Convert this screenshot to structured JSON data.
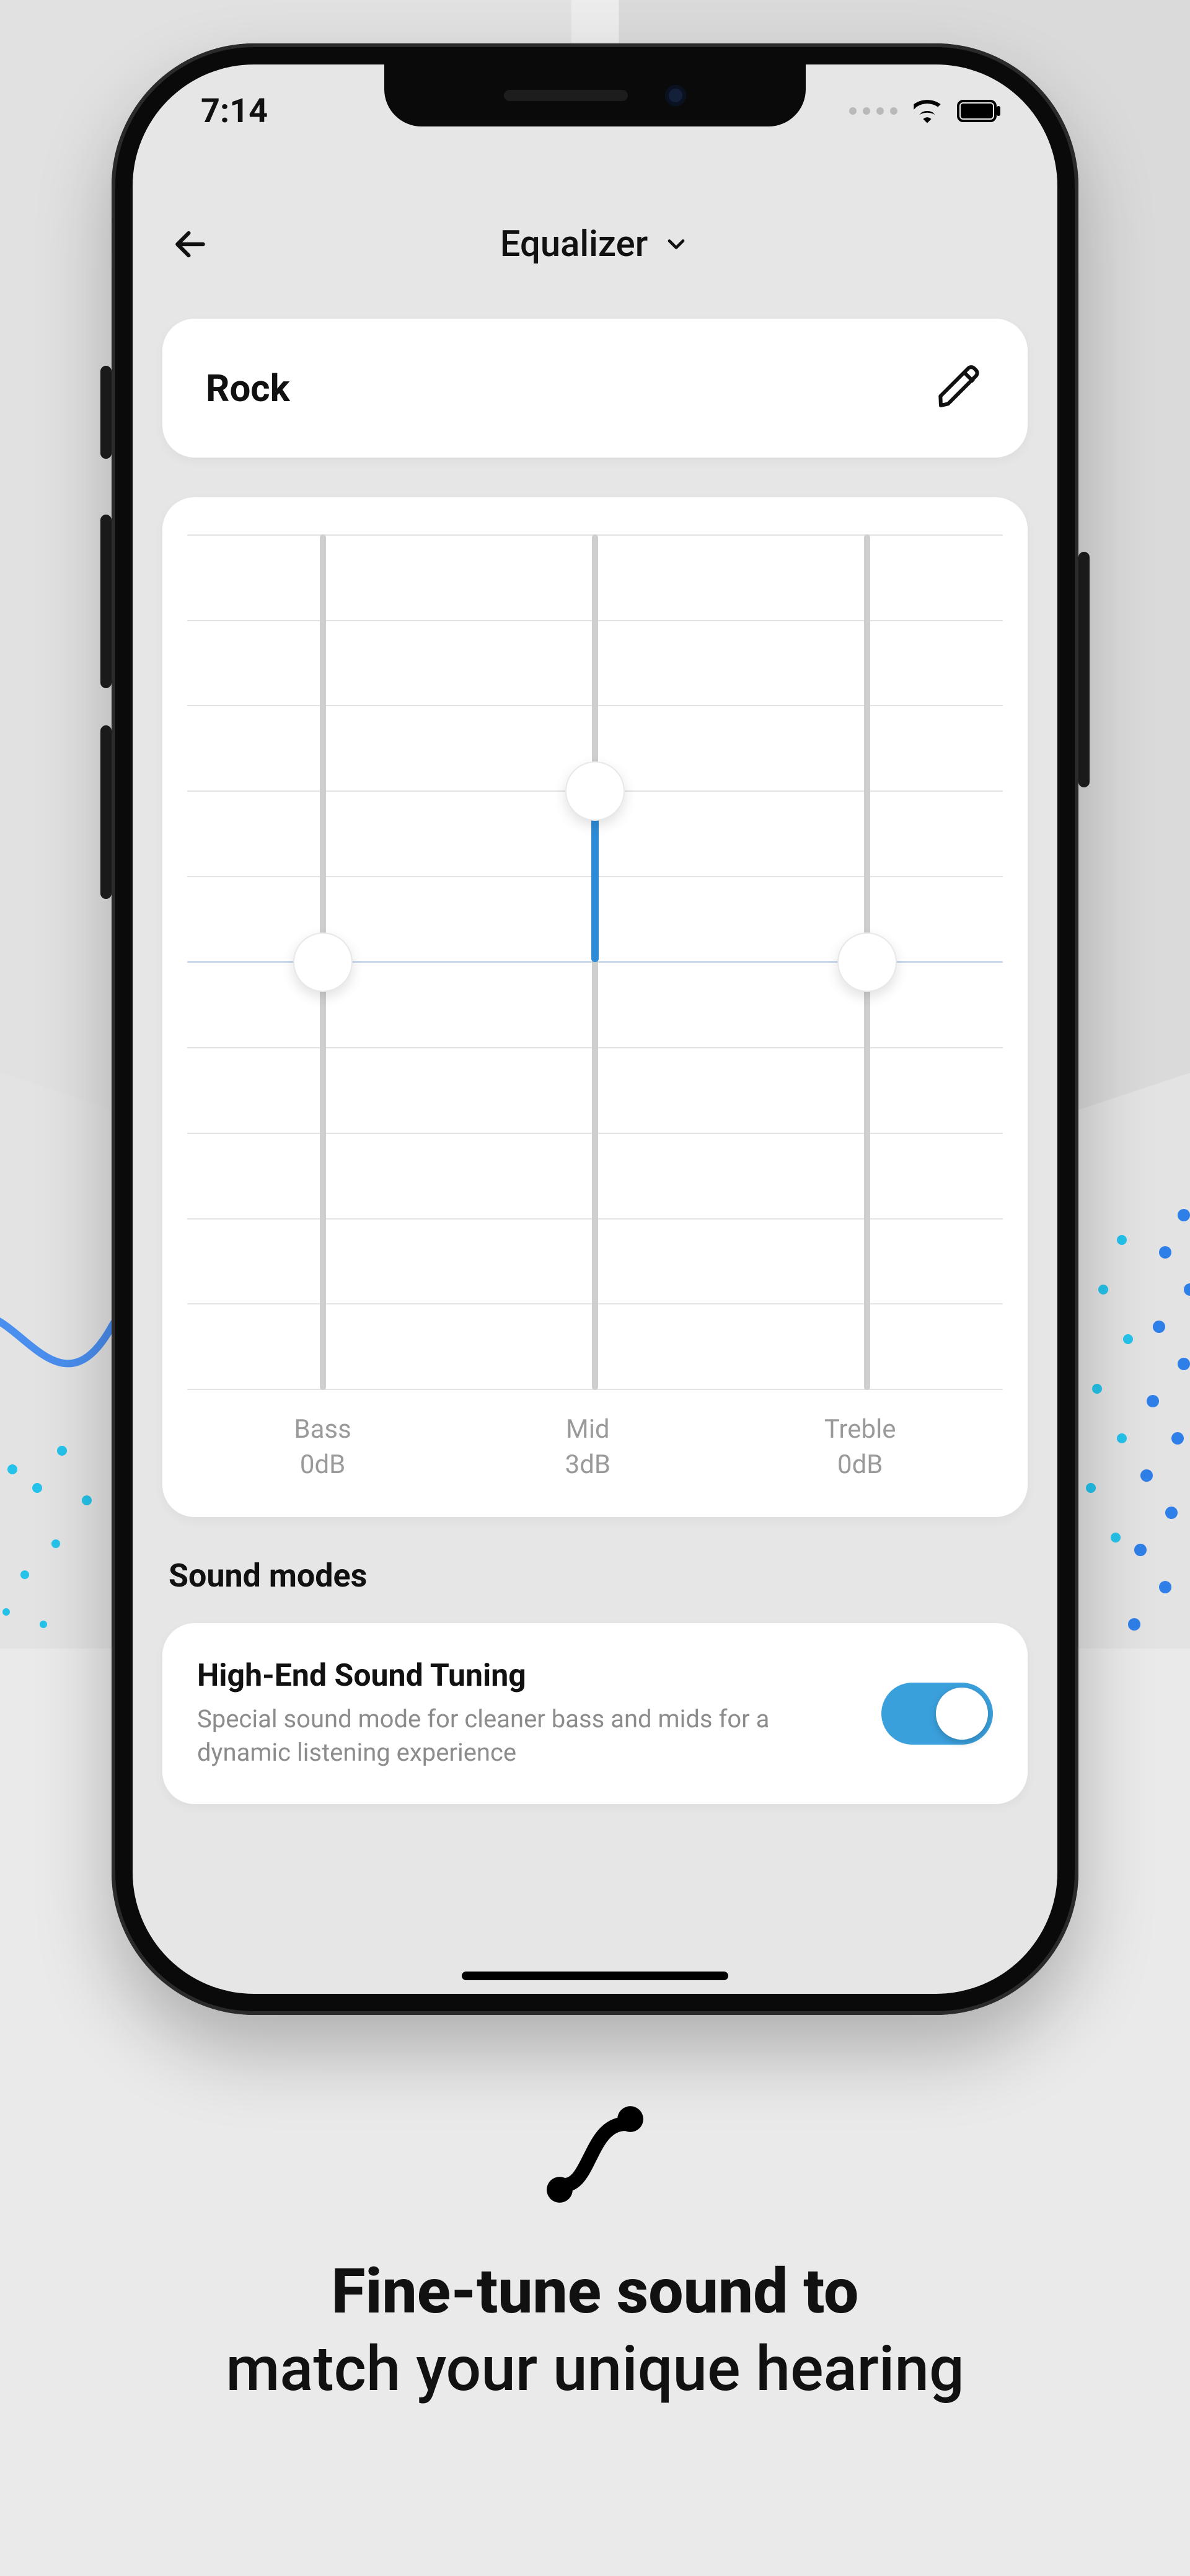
{
  "statusbar": {
    "time": "7:14"
  },
  "header": {
    "title": "Equalizer"
  },
  "preset": {
    "name": "Rock"
  },
  "eq": {
    "bands": [
      {
        "name": "Bass",
        "value": "0dB",
        "pos": 50
      },
      {
        "name": "Mid",
        "value": "3dB",
        "pos": 30
      },
      {
        "name": "Treble",
        "value": "0dB",
        "pos": 50
      }
    ]
  },
  "soundModes": {
    "sectionTitle": "Sound modes",
    "highEnd": {
      "title": "High-End Sound Tuning",
      "desc": "Special sound mode for cleaner bass and mids for a dynamic listening experience",
      "on": true
    }
  },
  "promo": {
    "line1_bold": "Fine-tune sound to",
    "line2": "match your unique hearing"
  }
}
